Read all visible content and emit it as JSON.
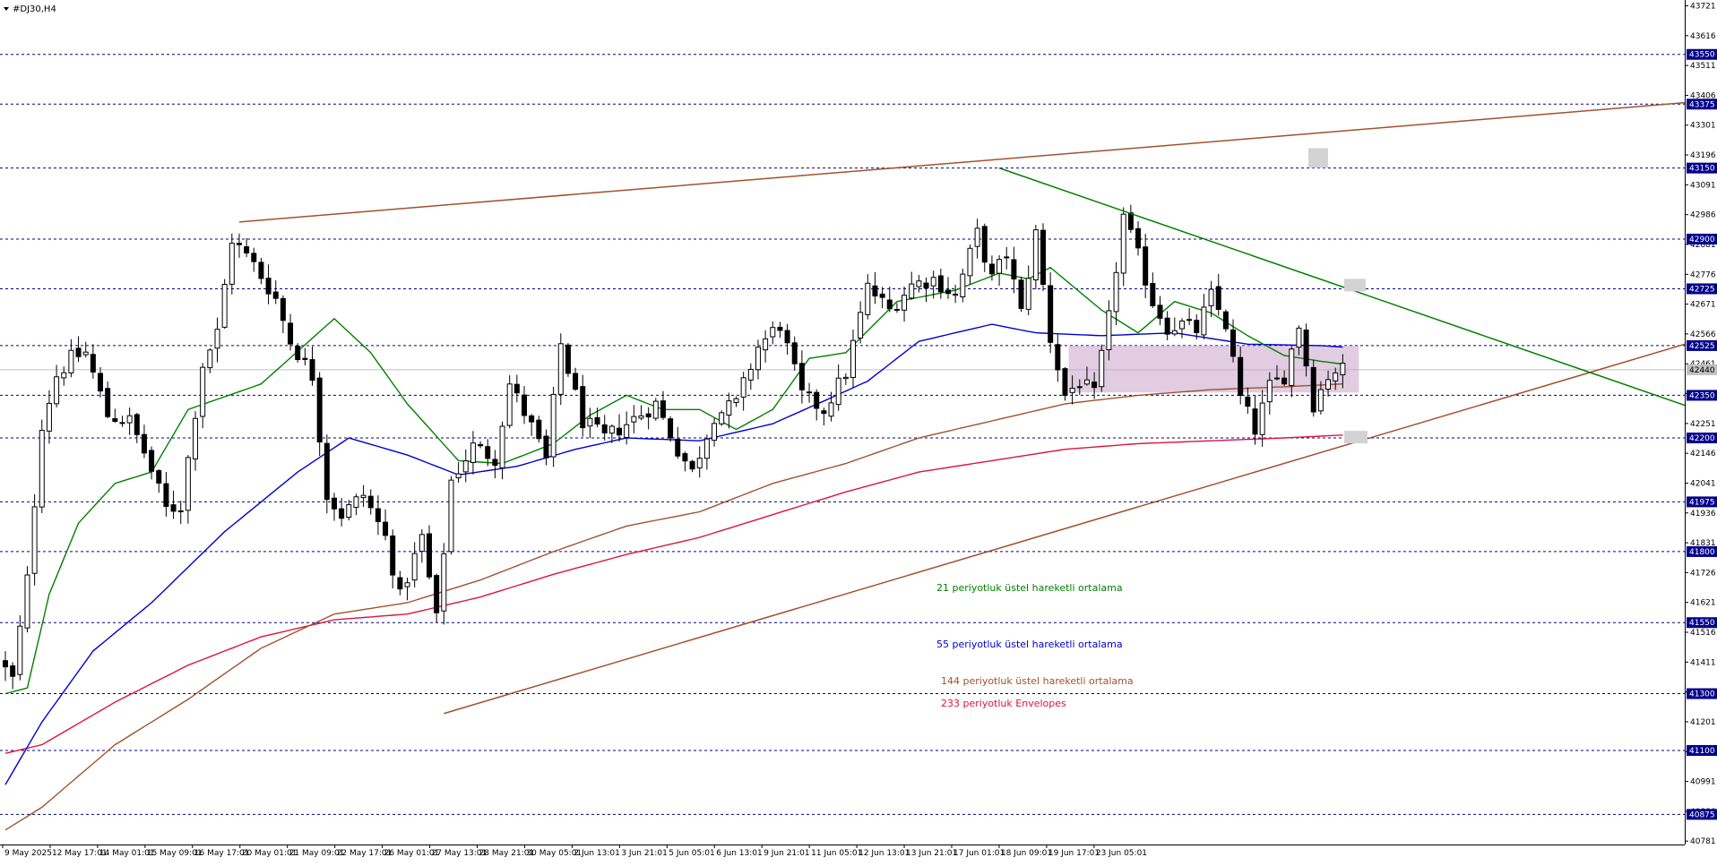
{
  "window": {
    "title": "#DJ30,H4",
    "menu_icon": "triangle-down-icon"
  },
  "chart_data": {
    "type": "candlestick",
    "symbol": "#DJ30",
    "timeframe": "H4",
    "title": "#DJ30,H4",
    "ylim": [
      40780,
      43721
    ],
    "grid": false,
    "price_axis_labels": [
      "43721",
      "43616",
      "43511",
      "43406",
      "43301",
      "43196",
      "43091",
      "42986",
      "42881",
      "42776",
      "42671",
      "42566",
      "42461",
      "42356",
      "42251",
      "42146",
      "42041",
      "41936",
      "41831",
      "41726",
      "41621",
      "41516",
      "41411",
      "41306",
      "41201",
      "41096",
      "40991",
      "40886",
      "40781"
    ],
    "levels": [
      "43550",
      "43375",
      "43150",
      "42900",
      "42725",
      "42525",
      "42350",
      "42200",
      "41975",
      "41800",
      "41550",
      "41300",
      "41100",
      "40875"
    ],
    "current_price": "42440",
    "time_axis_labels": [
      "9 May 2025",
      "12 May 17:01",
      "14 May 01:01",
      "15 May 09:01",
      "16 May 17:01",
      "20 May 01:01",
      "21 May 09:01",
      "22 May 17:01",
      "26 May 01:01",
      "27 May 13:01",
      "28 May 21:01",
      "30 May 05:01",
      "2 Jun 13:01",
      "3 Jun 21:01",
      "5 Jun 05:01",
      "6 Jun 13:01",
      "9 Jun 21:01",
      "11 Jun 05:01",
      "12 Jun 13:01",
      "13 Jun 21:01",
      "17 Jun 01:01",
      "18 Jun 09:01",
      "19 Jun 17:01",
      "23 Jun 05:01"
    ],
    "annotations": [
      "21 periyotluk üstel hareketli ortalama",
      "55 periyotluk üstel hareketli ortalama",
      "144 periyotluk üstel hareketli ortalama",
      "233 periyotluk Envelopes"
    ],
    "series_colors": {
      "ema21": "#008000",
      "ema55": "#0000cd",
      "ema144": "#a0522d",
      "env233": "#dc143c",
      "trend_upper": "#a0522d",
      "trend_lower": "#a0522d",
      "trend_down": "#008000",
      "zone": "#c8a2c8",
      "level_line": "#00008b",
      "label_bg": "#00008b",
      "annot_ema21": "#008000",
      "annot_ema55": "#0000cd",
      "annot_ema144": "#a0522d",
      "annot_env233": "#dc143c"
    },
    "zone": {
      "from": 42360,
      "to": 42525
    },
    "trendlines": [
      {
        "name": "upper-resistance",
        "from": {
          "bar": 32,
          "price": 42960
        },
        "to": {
          "bar": 230,
          "price": 43380
        }
      },
      {
        "name": "lower-support",
        "from": {
          "bar": 60,
          "price": 41230
        },
        "to": {
          "bar": 230,
          "price": 42530
        }
      },
      {
        "name": "descending",
        "from": {
          "bar": 136,
          "price": 43150
        },
        "to": {
          "bar": 230,
          "price": 42315
        }
      }
    ],
    "ema_anchors": {
      "ema21": [
        [
          0,
          41300
        ],
        [
          3,
          41320
        ],
        [
          6,
          41650
        ],
        [
          10,
          41900
        ],
        [
          15,
          42040
        ],
        [
          20,
          42080
        ],
        [
          25,
          42300
        ],
        [
          35,
          42390
        ],
        [
          45,
          42620
        ],
        [
          50,
          42500
        ],
        [
          55,
          42320
        ],
        [
          62,
          42120
        ],
        [
          68,
          42110
        ],
        [
          75,
          42180
        ],
        [
          80,
          42280
        ],
        [
          85,
          42350
        ],
        [
          90,
          42300
        ],
        [
          95,
          42300
        ],
        [
          100,
          42230
        ],
        [
          105,
          42300
        ],
        [
          110,
          42480
        ],
        [
          115,
          42500
        ],
        [
          122,
          42680
        ],
        [
          130,
          42720
        ],
        [
          136,
          42780
        ],
        [
          140,
          42760
        ],
        [
          143,
          42800
        ],
        [
          150,
          42650
        ],
        [
          155,
          42570
        ],
        [
          160,
          42680
        ],
        [
          165,
          42640
        ],
        [
          170,
          42560
        ],
        [
          175,
          42490
        ],
        [
          180,
          42470
        ],
        [
          183,
          42460
        ]
      ],
      "ema55": [
        [
          0,
          40980
        ],
        [
          5,
          41200
        ],
        [
          12,
          41450
        ],
        [
          20,
          41620
        ],
        [
          30,
          41870
        ],
        [
          40,
          42080
        ],
        [
          47,
          42200
        ],
        [
          55,
          42140
        ],
        [
          62,
          42070
        ],
        [
          70,
          42100
        ],
        [
          78,
          42160
        ],
        [
          85,
          42200
        ],
        [
          95,
          42190
        ],
        [
          105,
          42250
        ],
        [
          112,
          42330
        ],
        [
          118,
          42400
        ],
        [
          125,
          42540
        ],
        [
          135,
          42600
        ],
        [
          141,
          42570
        ],
        [
          150,
          42560
        ],
        [
          160,
          42570
        ],
        [
          170,
          42530
        ],
        [
          180,
          42525
        ],
        [
          183,
          42520
        ]
      ],
      "ema144": [
        [
          0,
          40820
        ],
        [
          5,
          40900
        ],
        [
          15,
          41120
        ],
        [
          25,
          41280
        ],
        [
          35,
          41460
        ],
        [
          45,
          41580
        ],
        [
          55,
          41620
        ],
        [
          65,
          41700
        ],
        [
          75,
          41800
        ],
        [
          85,
          41890
        ],
        [
          95,
          41940
        ],
        [
          105,
          42040
        ],
        [
          115,
          42110
        ],
        [
          125,
          42200
        ],
        [
          135,
          42260
        ],
        [
          145,
          42320
        ],
        [
          155,
          42350
        ],
        [
          165,
          42370
        ],
        [
          175,
          42380
        ],
        [
          183,
          42390
        ]
      ],
      "env233": [
        [
          0,
          41090
        ],
        [
          5,
          41120
        ],
        [
          15,
          41270
        ],
        [
          25,
          41400
        ],
        [
          35,
          41500
        ],
        [
          45,
          41560
        ],
        [
          55,
          41580
        ],
        [
          65,
          41640
        ],
        [
          75,
          41720
        ],
        [
          85,
          41790
        ],
        [
          95,
          41850
        ],
        [
          105,
          41930
        ],
        [
          115,
          42010
        ],
        [
          125,
          42080
        ],
        [
          135,
          42120
        ],
        [
          145,
          42160
        ],
        [
          155,
          42180
        ],
        [
          165,
          42190
        ],
        [
          175,
          42200
        ],
        [
          183,
          42210
        ]
      ]
    },
    "candle_anchors": [
      [
        0,
        41420
      ],
      [
        2,
        41350
      ],
      [
        4,
        41700
      ],
      [
        6,
        42250
      ],
      [
        8,
        42420
      ],
      [
        10,
        42480
      ],
      [
        12,
        42500
      ],
      [
        15,
        42280
      ],
      [
        18,
        42260
      ],
      [
        20,
        42150
      ],
      [
        23,
        41950
      ],
      [
        25,
        41960
      ],
      [
        28,
        42460
      ],
      [
        30,
        42570
      ],
      [
        32,
        42900
      ],
      [
        35,
        42810
      ],
      [
        38,
        42690
      ],
      [
        40,
        42540
      ],
      [
        43,
        42420
      ],
      [
        45,
        42000
      ],
      [
        47,
        41930
      ],
      [
        50,
        42000
      ],
      [
        53,
        41850
      ],
      [
        55,
        41640
      ],
      [
        58,
        41850
      ],
      [
        60,
        41560
      ],
      [
        62,
        42050
      ],
      [
        65,
        42170
      ],
      [
        68,
        42130
      ],
      [
        70,
        42390
      ],
      [
        73,
        42240
      ],
      [
        75,
        42120
      ],
      [
        77,
        42530
      ],
      [
        80,
        42260
      ],
      [
        83,
        42200
      ],
      [
        86,
        42250
      ],
      [
        90,
        42320
      ],
      [
        93,
        42160
      ],
      [
        95,
        42080
      ],
      [
        98,
        42280
      ],
      [
        101,
        42320
      ],
      [
        104,
        42520
      ],
      [
        107,
        42600
      ],
      [
        110,
        42350
      ],
      [
        113,
        42300
      ],
      [
        116,
        42430
      ],
      [
        119,
        42730
      ],
      [
        122,
        42650
      ],
      [
        125,
        42740
      ],
      [
        128,
        42760
      ],
      [
        131,
        42700
      ],
      [
        134,
        42920
      ],
      [
        136,
        42760
      ],
      [
        138,
        42850
      ],
      [
        140,
        42640
      ],
      [
        142,
        42920
      ],
      [
        144,
        42550
      ],
      [
        146,
        42350
      ],
      [
        148,
        42400
      ],
      [
        150,
        42350
      ],
      [
        152,
        42620
      ],
      [
        154,
        42980
      ],
      [
        156,
        42840
      ],
      [
        158,
        42680
      ],
      [
        160,
        42590
      ],
      [
        162,
        42600
      ],
      [
        164,
        42580
      ],
      [
        166,
        42700
      ],
      [
        168,
        42600
      ],
      [
        170,
        42340
      ],
      [
        172,
        42230
      ],
      [
        174,
        42380
      ],
      [
        176,
        42420
      ],
      [
        178,
        42600
      ],
      [
        180,
        42320
      ],
      [
        182,
        42420
      ],
      [
        183,
        42440
      ]
    ]
  }
}
